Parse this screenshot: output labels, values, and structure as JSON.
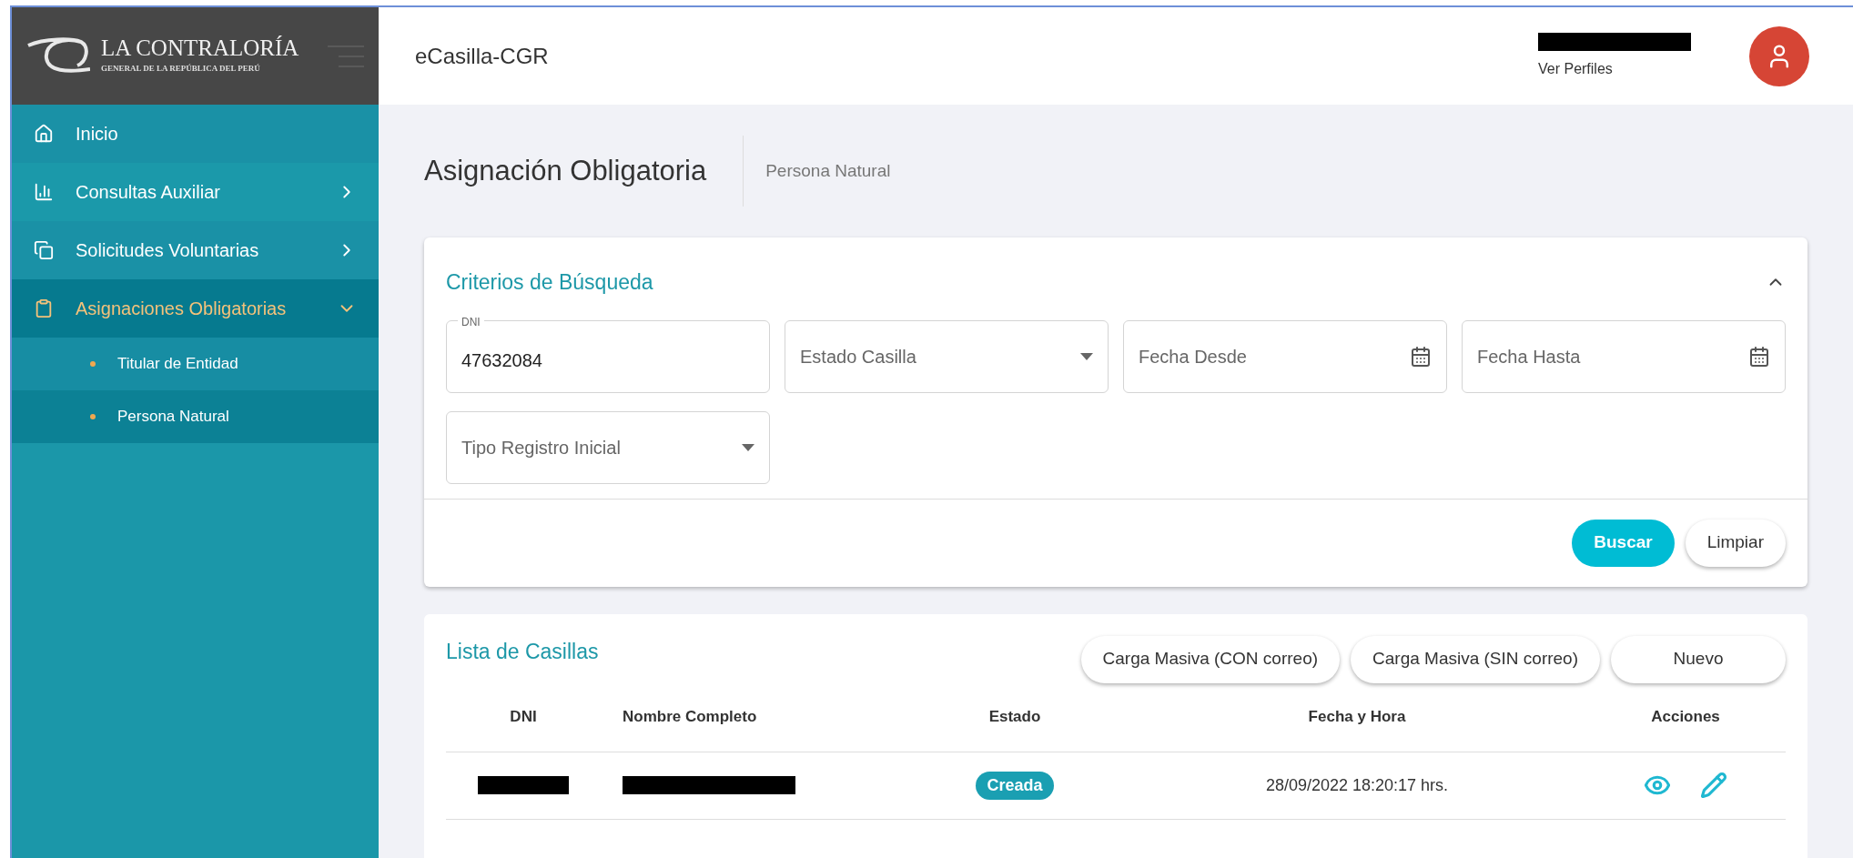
{
  "brand": {
    "name": "LA CONTRALORÍA",
    "subtitle": "GENERAL DE LA REPÚBLICA DEL PERÚ"
  },
  "header": {
    "app_title": "eCasilla-CGR",
    "user": {
      "redacted": true,
      "link": "Ver Perfiles"
    }
  },
  "sidebar": {
    "items": [
      {
        "label": "Inicio",
        "kind": "link",
        "selected": false
      },
      {
        "label": "Consultas Auxiliar",
        "kind": "group",
        "selected": false,
        "expanded": false
      },
      {
        "label": "Solicitudes Voluntarias",
        "kind": "group",
        "selected": false,
        "expanded": false
      },
      {
        "label": "Asignaciones Obligatorias",
        "kind": "group",
        "selected": true,
        "expanded": true,
        "children": [
          {
            "label": "Titular de Entidad",
            "selected": false
          },
          {
            "label": "Persona Natural",
            "selected": true
          }
        ]
      }
    ]
  },
  "page": {
    "title": "Asignación Obligatoria",
    "breadcrumb": "Persona Natural"
  },
  "search": {
    "title": "Criterios de Búsqueda",
    "expanded": true,
    "fields": [
      {
        "kind": "text",
        "label": "DNI",
        "value": "47632084"
      },
      {
        "kind": "select",
        "placeholder": "Estado Casilla"
      },
      {
        "kind": "date",
        "placeholder": "Fecha Desde"
      },
      {
        "kind": "date",
        "placeholder": "Fecha Hasta"
      },
      {
        "kind": "select",
        "placeholder": "Tipo Registro Inicial"
      }
    ],
    "buttons": [
      {
        "label": "Buscar",
        "kind": "primary"
      },
      {
        "label": "Limpiar",
        "kind": "secondary"
      }
    ]
  },
  "list": {
    "title": "Lista de Casillas",
    "buttons": [
      "Carga Masiva (CON correo)",
      "Carga Masiva (SIN correo)",
      "Nuevo"
    ],
    "columns": [
      "DNI",
      "Nombre Completo",
      "Estado",
      "Fecha y Hora",
      "Acciones"
    ],
    "rows": [
      {
        "cells": [
          {
            "kind": "redacted"
          },
          {
            "kind": "redacted"
          },
          {
            "kind": "badge",
            "text": "Creada"
          },
          {
            "kind": "text",
            "text": "28/09/2022 18:20:17 hrs."
          }
        ],
        "actions": [
          {
            "kind": "view"
          },
          {
            "kind": "edit"
          }
        ]
      }
    ]
  }
}
